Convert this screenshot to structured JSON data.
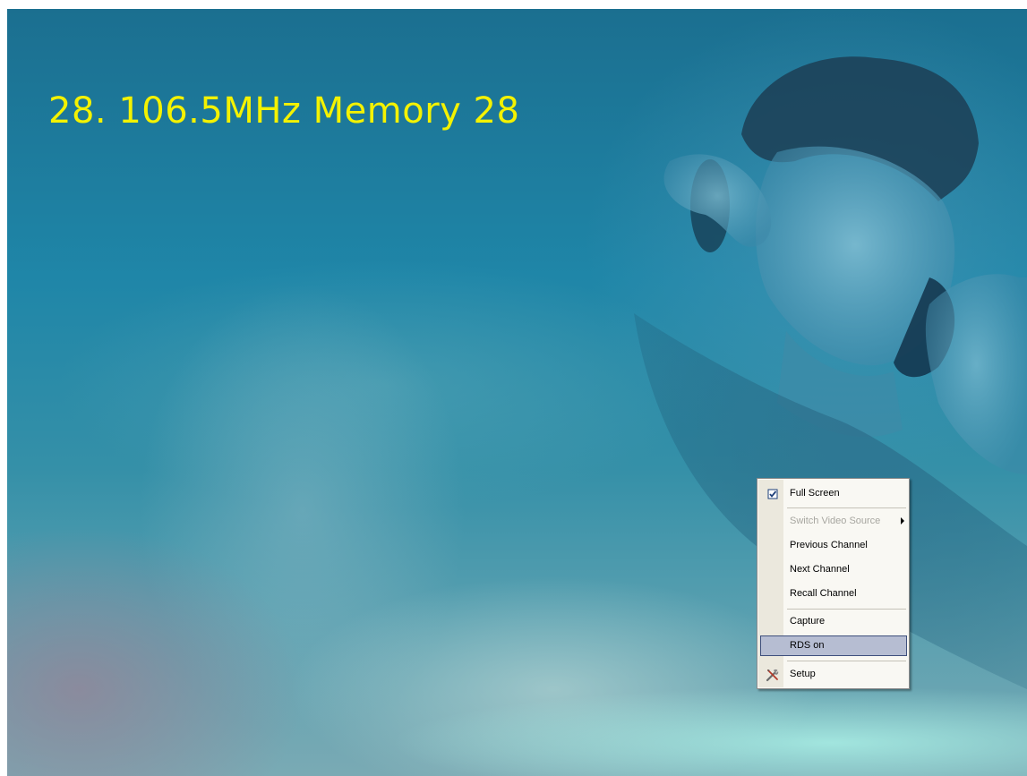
{
  "osd": {
    "station_text": "28. 106.5MHz Memory 28",
    "text_color": "#f4f200"
  },
  "context_menu": {
    "items": [
      {
        "label": "Full Screen",
        "checked": true,
        "icon": "checkbox-checked-icon"
      },
      {
        "label": "Switch Video Source",
        "disabled": true,
        "has_submenu": true
      },
      {
        "label": "Previous Channel"
      },
      {
        "label": "Next Channel"
      },
      {
        "label": "Recall Channel"
      },
      {
        "label": "Capture"
      },
      {
        "label": "RDS on",
        "highlighted": true
      },
      {
        "label": "Setup",
        "icon": "tools-icon"
      }
    ],
    "highlight_color": "#b6bdd2"
  }
}
